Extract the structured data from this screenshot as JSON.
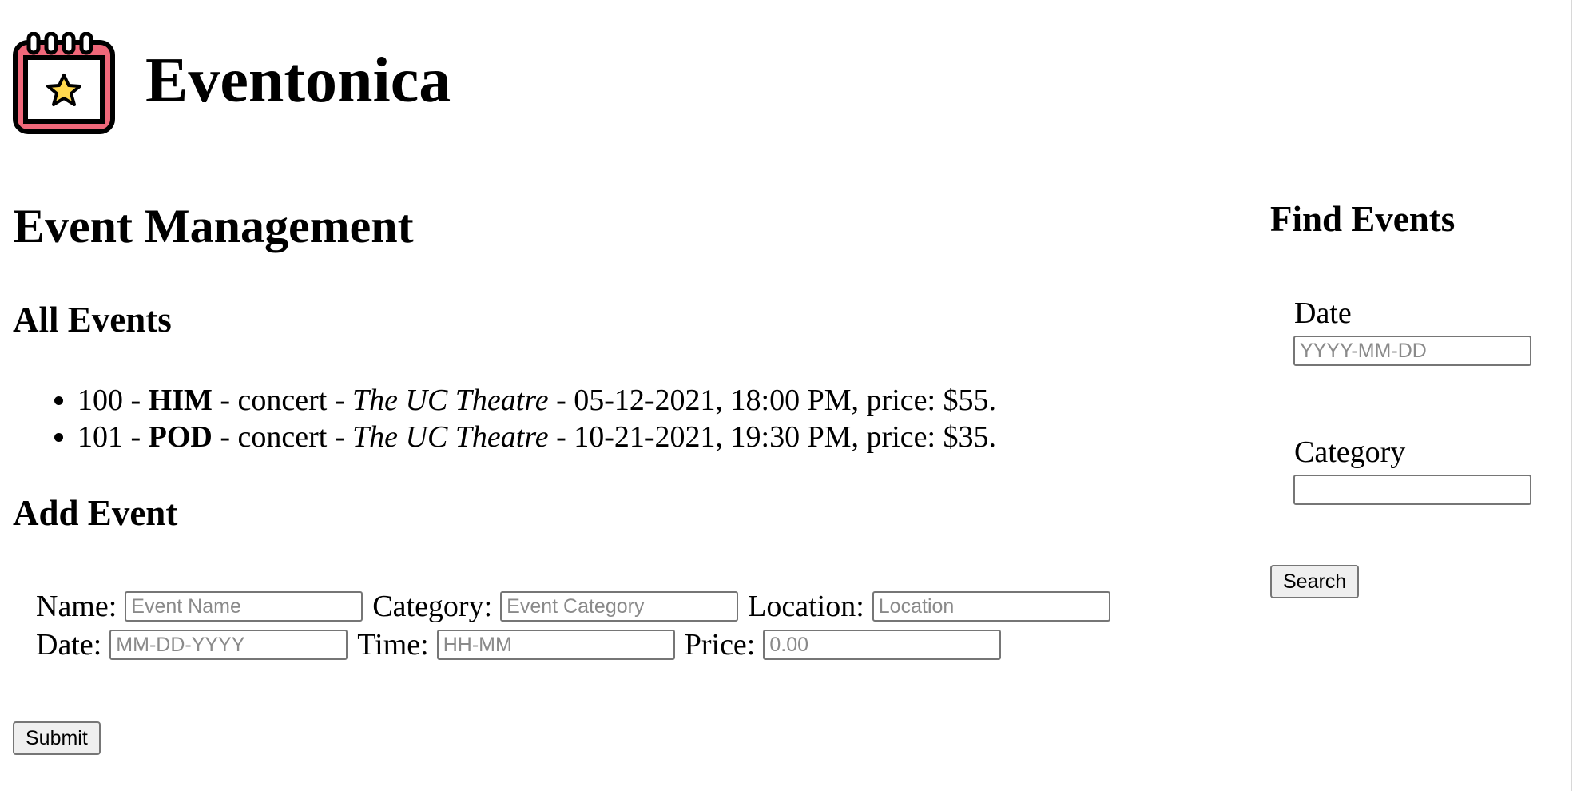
{
  "app": {
    "title": "Eventonica",
    "logo_icon": "calendar-star-icon",
    "colors": {
      "logo_red": "#f0687a",
      "logo_star": "#ffd84e"
    }
  },
  "main": {
    "heading": "Event Management",
    "all_events_heading": "All Events",
    "events": [
      {
        "id": "100",
        "name": "HIM",
        "category": "concert",
        "location": "The UC Theatre",
        "datetime": "05-12-2021, 18:00 PM, price: $55."
      },
      {
        "id": "101",
        "name": "POD",
        "category": "concert",
        "location": "The UC Theatre",
        "datetime": "10-21-2021, 19:30 PM, price: $35."
      }
    ],
    "add_event_heading": "Add Event",
    "form": {
      "name_label": "Name:",
      "name_placeholder": "Event Name",
      "category_label": "Category:",
      "category_placeholder": "Event Category",
      "location_label": "Location:",
      "location_placeholder": "Location",
      "date_label": "Date:",
      "date_placeholder": "MM-DD-YYYY",
      "time_label": "Time:",
      "time_placeholder": "HH-MM",
      "price_label": "Price:",
      "price_placeholder": "0.00",
      "submit_label": "Submit"
    }
  },
  "sidebar": {
    "heading": "Find Events",
    "date_label": "Date",
    "date_placeholder": "YYYY-MM-DD",
    "category_label": "Category",
    "category_value": "",
    "search_label": "Search"
  }
}
